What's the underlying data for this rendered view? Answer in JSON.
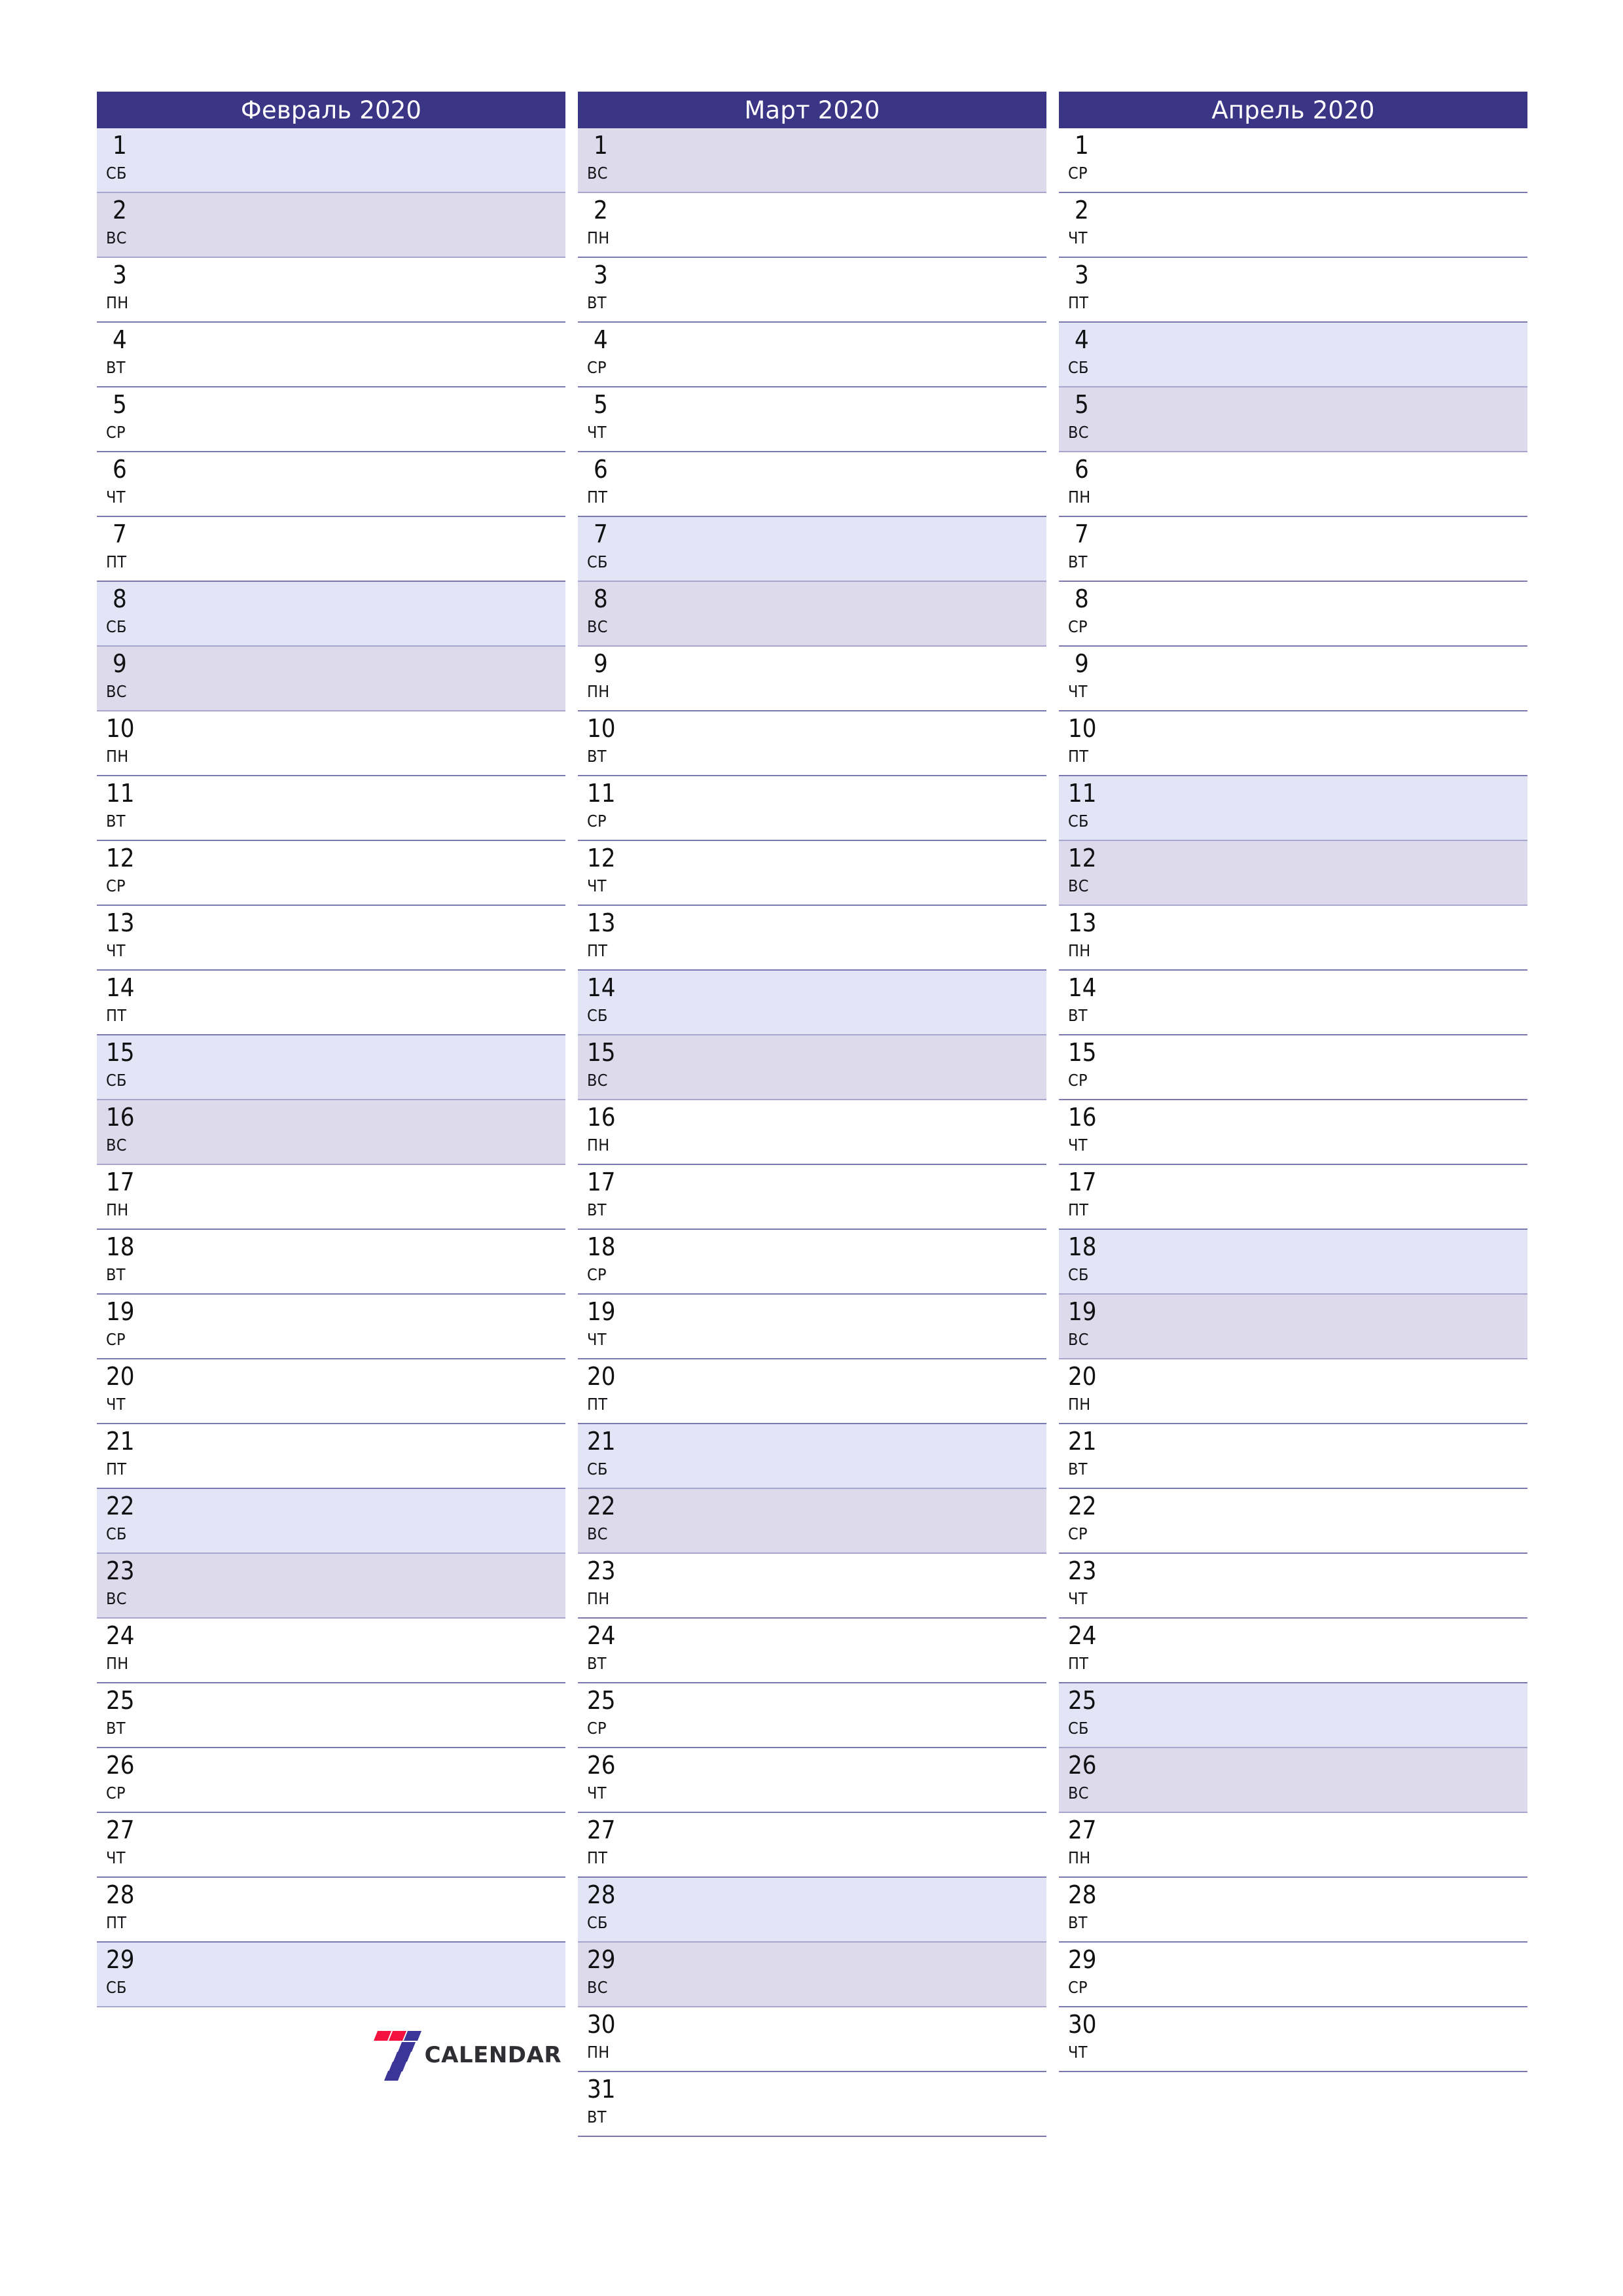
{
  "document": {
    "type": "monthly-planner",
    "locale": "ru",
    "logo": {
      "text": "CALENDAR",
      "mark_name": "seven-logo-icon",
      "colors": {
        "red": "#F4123F",
        "blue": "#3B3598",
        "text": "#2f2f33"
      }
    }
  },
  "theme": {
    "header_bg": "#3B3585",
    "header_text": "#FFFFFF",
    "saturday_bg": "#E4E4F7",
    "sunday_bg": "#DCDAEB",
    "row_border": "#7B7AB0",
    "weekend_row_border": "#A7A6CE",
    "page_bg": "#FFFFFF",
    "day_text": "#111114"
  },
  "months": [
    {
      "title": "Февраль 2020",
      "name": "Февраль",
      "year": "2020",
      "days": [
        {
          "num": "1",
          "wd": "СБ",
          "kind": "sat"
        },
        {
          "num": "2",
          "wd": "ВС",
          "kind": "sun"
        },
        {
          "num": "3",
          "wd": "ПН",
          "kind": "wd"
        },
        {
          "num": "4",
          "wd": "ВТ",
          "kind": "wd"
        },
        {
          "num": "5",
          "wd": "СР",
          "kind": "wd"
        },
        {
          "num": "6",
          "wd": "ЧТ",
          "kind": "wd"
        },
        {
          "num": "7",
          "wd": "ПТ",
          "kind": "wd"
        },
        {
          "num": "8",
          "wd": "СБ",
          "kind": "sat"
        },
        {
          "num": "9",
          "wd": "ВС",
          "kind": "sun"
        },
        {
          "num": "10",
          "wd": "ПН",
          "kind": "wd"
        },
        {
          "num": "11",
          "wd": "ВТ",
          "kind": "wd"
        },
        {
          "num": "12",
          "wd": "СР",
          "kind": "wd"
        },
        {
          "num": "13",
          "wd": "ЧТ",
          "kind": "wd"
        },
        {
          "num": "14",
          "wd": "ПТ",
          "kind": "wd"
        },
        {
          "num": "15",
          "wd": "СБ",
          "kind": "sat"
        },
        {
          "num": "16",
          "wd": "ВС",
          "kind": "sun"
        },
        {
          "num": "17",
          "wd": "ПН",
          "kind": "wd"
        },
        {
          "num": "18",
          "wd": "ВТ",
          "kind": "wd"
        },
        {
          "num": "19",
          "wd": "СР",
          "kind": "wd"
        },
        {
          "num": "20",
          "wd": "ЧТ",
          "kind": "wd"
        },
        {
          "num": "21",
          "wd": "ПТ",
          "kind": "wd"
        },
        {
          "num": "22",
          "wd": "СБ",
          "kind": "sat"
        },
        {
          "num": "23",
          "wd": "ВС",
          "kind": "sun"
        },
        {
          "num": "24",
          "wd": "ПН",
          "kind": "wd"
        },
        {
          "num": "25",
          "wd": "ВТ",
          "kind": "wd"
        },
        {
          "num": "26",
          "wd": "СР",
          "kind": "wd"
        },
        {
          "num": "27",
          "wd": "ЧТ",
          "kind": "wd"
        },
        {
          "num": "28",
          "wd": "ПТ",
          "kind": "wd"
        },
        {
          "num": "29",
          "wd": "СБ",
          "kind": "sat"
        }
      ]
    },
    {
      "title": "Март 2020",
      "name": "Март",
      "year": "2020",
      "days": [
        {
          "num": "1",
          "wd": "ВС",
          "kind": "sun"
        },
        {
          "num": "2",
          "wd": "ПН",
          "kind": "wd"
        },
        {
          "num": "3",
          "wd": "ВТ",
          "kind": "wd"
        },
        {
          "num": "4",
          "wd": "СР",
          "kind": "wd"
        },
        {
          "num": "5",
          "wd": "ЧТ",
          "kind": "wd"
        },
        {
          "num": "6",
          "wd": "ПТ",
          "kind": "wd"
        },
        {
          "num": "7",
          "wd": "СБ",
          "kind": "sat"
        },
        {
          "num": "8",
          "wd": "ВС",
          "kind": "sun"
        },
        {
          "num": "9",
          "wd": "ПН",
          "kind": "wd"
        },
        {
          "num": "10",
          "wd": "ВТ",
          "kind": "wd"
        },
        {
          "num": "11",
          "wd": "СР",
          "kind": "wd"
        },
        {
          "num": "12",
          "wd": "ЧТ",
          "kind": "wd"
        },
        {
          "num": "13",
          "wd": "ПТ",
          "kind": "wd"
        },
        {
          "num": "14",
          "wd": "СБ",
          "kind": "sat"
        },
        {
          "num": "15",
          "wd": "ВС",
          "kind": "sun"
        },
        {
          "num": "16",
          "wd": "ПН",
          "kind": "wd"
        },
        {
          "num": "17",
          "wd": "ВТ",
          "kind": "wd"
        },
        {
          "num": "18",
          "wd": "СР",
          "kind": "wd"
        },
        {
          "num": "19",
          "wd": "ЧТ",
          "kind": "wd"
        },
        {
          "num": "20",
          "wd": "ПТ",
          "kind": "wd"
        },
        {
          "num": "21",
          "wd": "СБ",
          "kind": "sat"
        },
        {
          "num": "22",
          "wd": "ВС",
          "kind": "sun"
        },
        {
          "num": "23",
          "wd": "ПН",
          "kind": "wd"
        },
        {
          "num": "24",
          "wd": "ВТ",
          "kind": "wd"
        },
        {
          "num": "25",
          "wd": "СР",
          "kind": "wd"
        },
        {
          "num": "26",
          "wd": "ЧТ",
          "kind": "wd"
        },
        {
          "num": "27",
          "wd": "ПТ",
          "kind": "wd"
        },
        {
          "num": "28",
          "wd": "СБ",
          "kind": "sat"
        },
        {
          "num": "29",
          "wd": "ВС",
          "kind": "sun"
        },
        {
          "num": "30",
          "wd": "ПН",
          "kind": "wd"
        },
        {
          "num": "31",
          "wd": "ВТ",
          "kind": "wd"
        }
      ]
    },
    {
      "title": "Апрель 2020",
      "name": "Апрель",
      "year": "2020",
      "days": [
        {
          "num": "1",
          "wd": "СР",
          "kind": "wd"
        },
        {
          "num": "2",
          "wd": "ЧТ",
          "kind": "wd"
        },
        {
          "num": "3",
          "wd": "ПТ",
          "kind": "wd"
        },
        {
          "num": "4",
          "wd": "СБ",
          "kind": "sat"
        },
        {
          "num": "5",
          "wd": "ВС",
          "kind": "sun"
        },
        {
          "num": "6",
          "wd": "ПН",
          "kind": "wd"
        },
        {
          "num": "7",
          "wd": "ВТ",
          "kind": "wd"
        },
        {
          "num": "8",
          "wd": "СР",
          "kind": "wd"
        },
        {
          "num": "9",
          "wd": "ЧТ",
          "kind": "wd"
        },
        {
          "num": "10",
          "wd": "ПТ",
          "kind": "wd"
        },
        {
          "num": "11",
          "wd": "СБ",
          "kind": "sat"
        },
        {
          "num": "12",
          "wd": "ВС",
          "kind": "sun"
        },
        {
          "num": "13",
          "wd": "ПН",
          "kind": "wd"
        },
        {
          "num": "14",
          "wd": "ВТ",
          "kind": "wd"
        },
        {
          "num": "15",
          "wd": "СР",
          "kind": "wd"
        },
        {
          "num": "16",
          "wd": "ЧТ",
          "kind": "wd"
        },
        {
          "num": "17",
          "wd": "ПТ",
          "kind": "wd"
        },
        {
          "num": "18",
          "wd": "СБ",
          "kind": "sat"
        },
        {
          "num": "19",
          "wd": "ВС",
          "kind": "sun"
        },
        {
          "num": "20",
          "wd": "ПН",
          "kind": "wd"
        },
        {
          "num": "21",
          "wd": "ВТ",
          "kind": "wd"
        },
        {
          "num": "22",
          "wd": "СР",
          "kind": "wd"
        },
        {
          "num": "23",
          "wd": "ЧТ",
          "kind": "wd"
        },
        {
          "num": "24",
          "wd": "ПТ",
          "kind": "wd"
        },
        {
          "num": "25",
          "wd": "СБ",
          "kind": "sat"
        },
        {
          "num": "26",
          "wd": "ВС",
          "kind": "sun"
        },
        {
          "num": "27",
          "wd": "ПН",
          "kind": "wd"
        },
        {
          "num": "28",
          "wd": "ВТ",
          "kind": "wd"
        },
        {
          "num": "29",
          "wd": "СР",
          "kind": "wd"
        },
        {
          "num": "30",
          "wd": "ЧТ",
          "kind": "wd"
        }
      ]
    }
  ]
}
